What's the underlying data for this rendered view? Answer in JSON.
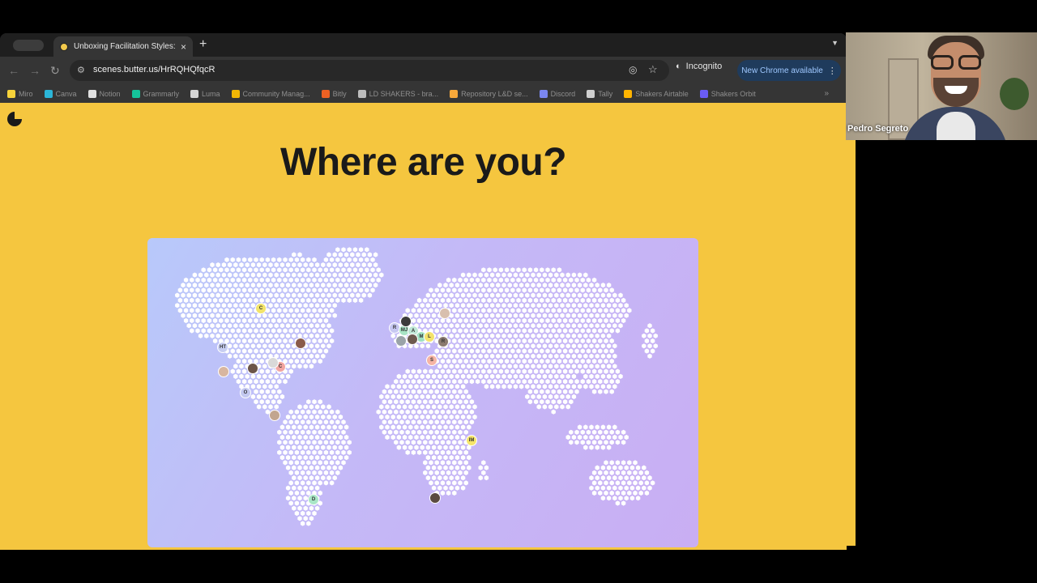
{
  "browser": {
    "tab_title": "Unboxing Facilitation Styles:",
    "new_tab": "+",
    "close": "×",
    "url": "scenes.butter.us/HrRQHQfqcR",
    "incognito_label": "Incognito",
    "update_label": "New Chrome available",
    "bookmarks": [
      {
        "label": "Miro",
        "color": "#f7d33a"
      },
      {
        "label": "Canva",
        "color": "#2bb5d8"
      },
      {
        "label": "Notion",
        "color": "#e0e0e0"
      },
      {
        "label": "Grammarly",
        "color": "#15c39a"
      },
      {
        "label": "Luma",
        "color": "#d6d6d6"
      },
      {
        "label": "Community Manag...",
        "color": "#f2b705"
      },
      {
        "label": "Bitly",
        "color": "#ee6123"
      },
      {
        "label": "LD SHAKERS - bra...",
        "color": "#bdbdbd"
      },
      {
        "label": "Repository L&D se...",
        "color": "#f7a83a"
      },
      {
        "label": "Discord",
        "color": "#7a86f0"
      },
      {
        "label": "Tally",
        "color": "#cfcfcf"
      },
      {
        "label": "Shakers Airtable",
        "color": "#ffb400"
      },
      {
        "label": "Shakers Orbit",
        "color": "#6a5cf5"
      }
    ]
  },
  "slide": {
    "headline": "Where are you?"
  },
  "pins": [
    {
      "label": "C",
      "color": "#f2e36a"
    },
    {
      "label": "HT",
      "color": "#c7cef2"
    },
    {
      "label": "",
      "color": "#d8b6a0"
    },
    {
      "label": "",
      "color": "#6b5448"
    },
    {
      "label": "C",
      "color": "#f2a5a0"
    },
    {
      "label": "",
      "color": "#d9d9d9"
    },
    {
      "label": "",
      "color": "#8a5b4a"
    },
    {
      "label": "O",
      "color": "#c3c8f0"
    },
    {
      "label": "",
      "color": "#c2a58f"
    },
    {
      "label": "R",
      "color": "#c7c8f2"
    },
    {
      "label": "MJ",
      "color": "#a7e3c4"
    },
    {
      "label": "",
      "color": "#3b3b3b"
    },
    {
      "label": "A",
      "color": "#bfe6d6"
    },
    {
      "label": "M",
      "color": "#9fe0c2"
    },
    {
      "label": "L",
      "color": "#f3e26b"
    },
    {
      "label": "",
      "color": "#9aa3a8"
    },
    {
      "label": "",
      "color": "#6d5a50"
    },
    {
      "label": "R",
      "color": "#8a7a70"
    },
    {
      "label": "",
      "color": "#d8bfae"
    },
    {
      "label": "S",
      "color": "#f6b4a4"
    },
    {
      "label": "IM",
      "color": "#f5e46a"
    },
    {
      "label": "D",
      "color": "#a9e6c6"
    },
    {
      "label": "",
      "color": "#5a4a40"
    }
  ],
  "participant": {
    "name": "Pedro Segreto"
  }
}
